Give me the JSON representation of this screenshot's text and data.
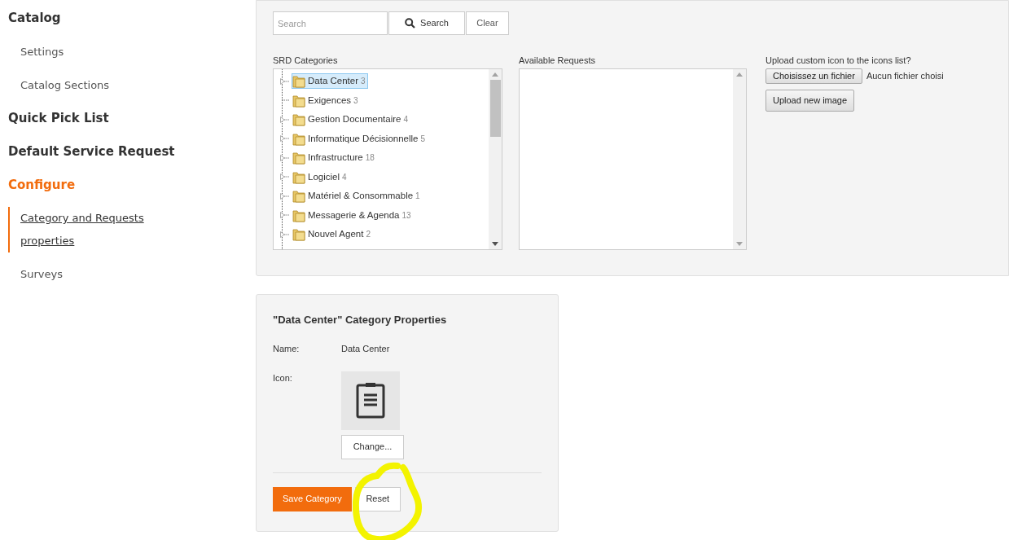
{
  "sidebar": {
    "items": [
      {
        "kind": "section",
        "label": "Catalog",
        "selected": false
      },
      {
        "kind": "link",
        "label": "Settings",
        "selected": false
      },
      {
        "kind": "link",
        "label": "Catalog Sections",
        "selected": false
      },
      {
        "kind": "section",
        "label": "Quick Pick List",
        "selected": false
      },
      {
        "kind": "section",
        "label": "Default Service Request",
        "selected": false
      },
      {
        "kind": "section",
        "label": "Configure",
        "selected": true
      },
      {
        "kind": "link",
        "label": "Category and Requests properties",
        "selected": true
      },
      {
        "kind": "link",
        "label": "Surveys",
        "selected": false
      }
    ]
  },
  "search": {
    "placeholder": "Search",
    "button": "Search",
    "clear": "Clear"
  },
  "categories": {
    "label": "SRD Categories",
    "items": [
      {
        "label": "Data Center",
        "count": "3",
        "selected": true,
        "has_children": true
      },
      {
        "label": "Exigences",
        "count": "3",
        "selected": false,
        "has_children": false
      },
      {
        "label": "Gestion Documentaire",
        "count": "4",
        "selected": false,
        "has_children": true
      },
      {
        "label": "Informatique Décisionnelle",
        "count": "5",
        "selected": false,
        "has_children": true
      },
      {
        "label": "Infrastructure",
        "count": "18",
        "selected": false,
        "has_children": true
      },
      {
        "label": "Logiciel",
        "count": "4",
        "selected": false,
        "has_children": true
      },
      {
        "label": "Matériel & Consommable",
        "count": "1",
        "selected": false,
        "has_children": true
      },
      {
        "label": "Messagerie & Agenda",
        "count": "13",
        "selected": false,
        "has_children": true
      },
      {
        "label": "Nouvel Agent",
        "count": "2",
        "selected": false,
        "has_children": true
      }
    ]
  },
  "requests": {
    "label": "Available Requests"
  },
  "upload": {
    "label": "Upload custom icon to the icons list?",
    "file_button": "Choisissez un fichier",
    "file_status": "Aucun fichier choisi",
    "upload_button": "Upload new image"
  },
  "properties": {
    "title": "\"Data Center\" Category Properties",
    "name_label": "Name:",
    "name_value": "Data Center",
    "icon_label": "Icon:",
    "change_button": "Change...",
    "save_button": "Save Category",
    "reset_button": "Reset"
  }
}
